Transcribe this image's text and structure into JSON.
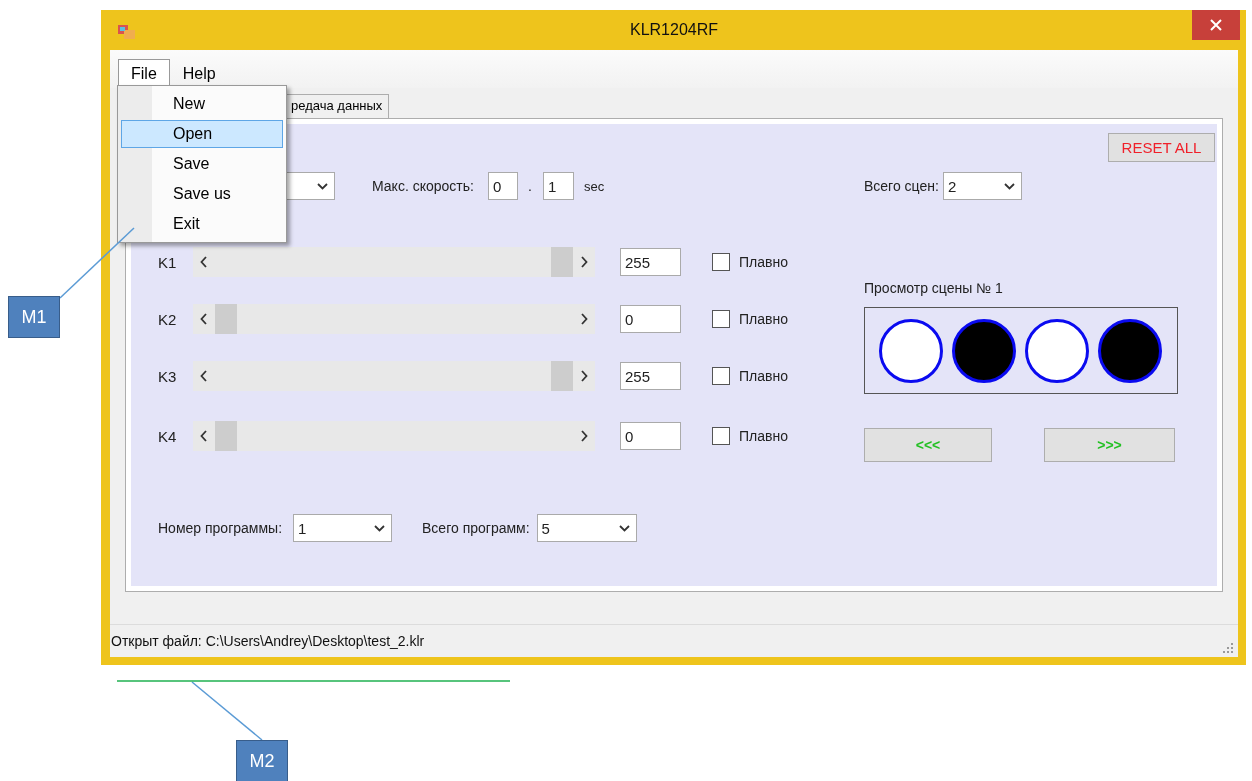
{
  "window": {
    "title": "KLR1204RF"
  },
  "menu_bar": [
    {
      "label": "File",
      "expanded": true
    },
    {
      "label": "Help",
      "expanded": false
    }
  ],
  "file_menu": [
    {
      "label": "New",
      "selected": false
    },
    {
      "label": "Open",
      "selected": true
    },
    {
      "label": "Save",
      "selected": false
    },
    {
      "label": "Save us",
      "selected": false
    },
    {
      "label": "Exit",
      "selected": false
    }
  ],
  "tabs": [
    {
      "label": "редача данных",
      "selected": false
    }
  ],
  "reset_button": "RESET ALL",
  "speed": {
    "label": "Макс. скорость:",
    "whole": "0",
    "separator": ".",
    "fraction": "1",
    "unit": "sec"
  },
  "scene_total": {
    "label": "Всего сцен:",
    "value": "2"
  },
  "channels": [
    {
      "name": "K1",
      "level": 1,
      "value": "255",
      "smooth_label": "Плавно",
      "checked": false
    },
    {
      "name": "K2",
      "level": 0,
      "value": "0",
      "smooth_label": "Плавно",
      "checked": false
    },
    {
      "name": "K3",
      "level": 1,
      "value": "255",
      "smooth_label": "Плавно",
      "checked": false
    },
    {
      "name": "K4",
      "level": 0,
      "value": "0",
      "smooth_label": "Плавно",
      "checked": false
    }
  ],
  "preview": {
    "title": "Просмотр сцены № 1",
    "lamps": [
      {
        "on": true
      },
      {
        "on": false
      },
      {
        "on": true
      },
      {
        "on": false
      }
    ]
  },
  "nav_buttons": [
    "<<<",
    ">>>"
  ],
  "program": {
    "number_label": "Номер программы:",
    "number": "1",
    "total_label": "Всего программ:",
    "total": "5"
  },
  "status_bar": "Открыт файл: C:\\Users\\Andrey\\Desktop\\test_2.klr",
  "callouts": [
    {
      "label": "M1"
    },
    {
      "label": "M2"
    }
  ]
}
